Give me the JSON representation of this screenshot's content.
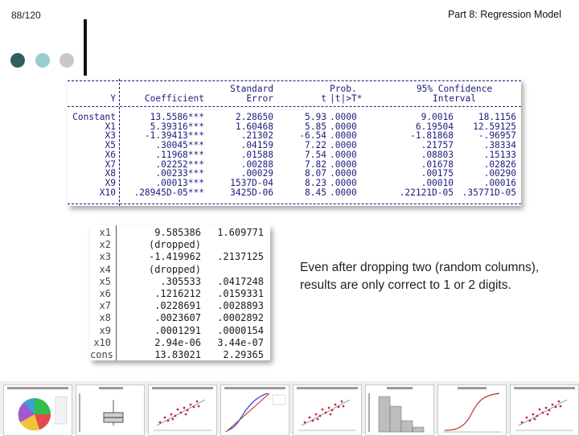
{
  "page_number": "88/120",
  "header_title": "Part 8: Regression Model",
  "regression_table": {
    "header1": [
      "",
      "",
      "Standard",
      "",
      "Prob.",
      "95% Confidence"
    ],
    "header2": [
      "Y",
      "Coefficient",
      "Error",
      "t",
      "|t|>T*",
      "Interval"
    ],
    "rows": [
      {
        "name": "Constant",
        "coef": "13.5586***",
        "se": "2.28650",
        "t": "5.93",
        "p": ".0000",
        "lo": "9.0016",
        "hi": "18.1156"
      },
      {
        "name": "X1",
        "coef": "5.39316***",
        "se": "1.60468",
        "t": "5.85",
        "p": ".0000",
        "lo": "6.19504",
        "hi": "12.59125"
      },
      {
        "name": "X3",
        "coef": "-1.39413***",
        "se": ".21302",
        "t": "-6.54",
        "p": ".0000",
        "lo": "-1.81868",
        "hi": "-.96957"
      },
      {
        "name": "X5",
        "coef": ".30045***",
        "se": ".04159",
        "t": "7.22",
        "p": ".0000",
        "lo": ".21757",
        "hi": ".38334"
      },
      {
        "name": "X6",
        "coef": ".11968***",
        "se": ".01588",
        "t": "7.54",
        "p": ".0000",
        "lo": ".08803",
        "hi": ".15133"
      },
      {
        "name": "X7",
        "coef": ".02252***",
        "se": ".00288",
        "t": "7.82",
        "p": ".0000",
        "lo": ".01678",
        "hi": ".02826"
      },
      {
        "name": "X8",
        "coef": ".00233***",
        "se": ".00029",
        "t": "8.07",
        "p": ".0000",
        "lo": ".00175",
        "hi": ".00290"
      },
      {
        "name": "X9",
        "coef": ".00013***",
        "se": "1537D-04",
        "t": "8.23",
        "p": ".0000",
        "lo": ".00010",
        "hi": ".00016"
      },
      {
        "name": "X10",
        "coef": ".28945D-05***",
        "se": "3425D-06",
        "t": "8.45",
        "p": ".0000",
        "lo": ".22121D-05",
        "hi": ".35771D-05"
      }
    ]
  },
  "stata_table": {
    "rows": [
      {
        "name": "x1",
        "coef": "9.585386",
        "se": "1.609771"
      },
      {
        "name": "x2",
        "coef": "(dropped)",
        "se": ""
      },
      {
        "name": "x3",
        "coef": "-1.419962",
        "se": ".2137125"
      },
      {
        "name": "x4",
        "coef": "(dropped)",
        "se": ""
      },
      {
        "name": "x5",
        "coef": ".305533",
        "se": ".0417248"
      },
      {
        "name": "x6",
        "coef": ".1216212",
        "se": ".0159331"
      },
      {
        "name": "x7",
        "coef": ".0228691",
        "se": ".0028893"
      },
      {
        "name": "x8",
        "coef": ".0023607",
        "se": ".0002892"
      },
      {
        "name": "x9",
        "coef": ".0001291",
        "se": ".0000154"
      },
      {
        "name": "x10",
        "coef": "2.94e-06",
        "se": "3.44e-07"
      },
      {
        "name": "cons",
        "coef": "13.83021",
        "se": "2.29365"
      }
    ]
  },
  "note_text": "Even after dropping two (random columns), results are only correct to 1 or 2 digits.",
  "colors": {
    "dot1": "#2f5f5f",
    "dot2": "#95cdd2",
    "dot3": "#c8c8c8",
    "regression_text": "#1c1c7c"
  },
  "thumbnails": [
    {
      "kind": "pie-chart"
    },
    {
      "kind": "box-plot"
    },
    {
      "kind": "scatter-plot"
    },
    {
      "kind": "probability-plot"
    },
    {
      "kind": "scatter-plot"
    },
    {
      "kind": "histogram"
    },
    {
      "kind": "curve-plot"
    },
    {
      "kind": "scatter-plot"
    }
  ]
}
